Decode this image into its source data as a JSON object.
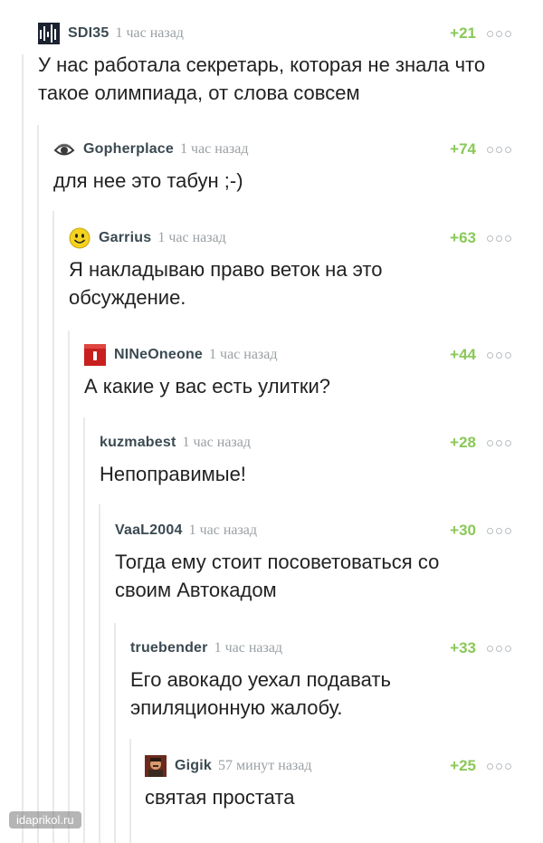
{
  "comments": [
    {
      "user": "SDI35",
      "time": "1 час назад",
      "score": "+21",
      "text": "У нас работала секретарь, которая не знала что такое олимпиада, от слова совсем",
      "avatar": "equalizer-avatar-icon"
    },
    {
      "user": "Gopherplace",
      "time": "1 час назад",
      "score": "+74",
      "text": "для нее это табун ;-)",
      "avatar": "eye-logo-avatar-icon"
    },
    {
      "user": "Garrius",
      "time": "1 час назад",
      "score": "+63",
      "text": "Я накладываю право веток на это обсуждение.",
      "avatar": "smiley-face-avatar-icon"
    },
    {
      "user": "NINeOneone",
      "time": "1 час назад",
      "score": "+44",
      "text": "А какие у вас есть улитки?",
      "avatar": "red-phone-avatar-icon"
    },
    {
      "user": "kuzmabest",
      "time": "1 час назад",
      "score": "+28",
      "text": "Непоправимые!",
      "avatar": ""
    },
    {
      "user": "VaaL2004",
      "time": "1 час назад",
      "score": "+30",
      "text": "Тогда ему стоит посоветоваться со своим Автокадом",
      "avatar": ""
    },
    {
      "user": "truebender",
      "time": "1 час назад",
      "score": "+33",
      "text": "Его авокадо уехал подавать эпиляционную жалобу.",
      "avatar": ""
    },
    {
      "user": "Gigik",
      "time": "57 минут назад",
      "score": "+25",
      "text": "святая простата",
      "avatar": "portrait-avatar-icon"
    }
  ],
  "watermark": "idaprikol.ru"
}
